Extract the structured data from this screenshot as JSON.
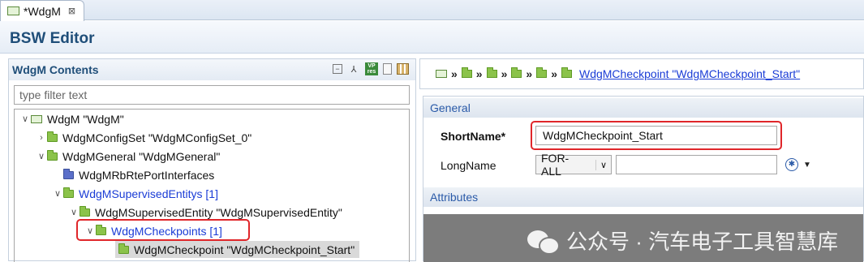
{
  "tab": {
    "label": "*WdgM",
    "close": "⊠"
  },
  "editor": {
    "title": "BSW Editor"
  },
  "contents": {
    "title": "WdgM Contents",
    "filter_placeholder": "type filter text",
    "toolbar_icons": [
      "collapse-all-icon",
      "hierarchy-icon",
      "vp-res-icon",
      "document-icon",
      "table-icon"
    ],
    "tree": [
      {
        "label": "WdgM \"WdgM\"",
        "expanded": true
      },
      {
        "label": "WdgMConfigSet \"WdgMConfigSet_0\"",
        "expanded": false
      },
      {
        "label": "WdgMGeneral \"WdgMGeneral\"",
        "expanded": true
      },
      {
        "label": "WdgMRbRtePortInterfaces"
      },
      {
        "label": "WdgMSupervisedEntitys [1]",
        "expanded": true
      },
      {
        "label": "WdgMSupervisedEntity \"WdgMSupervisedEntity\"",
        "expanded": true
      },
      {
        "label": "WdgMCheckpoints [1]",
        "expanded": true
      },
      {
        "label": "WdgMCheckpoint \"WdgMCheckpoint_Start\"",
        "selected": true
      }
    ]
  },
  "breadcrumb": {
    "separator": "»",
    "link": "WdgMCheckpoint \"WdgMCheckpoint_Start\""
  },
  "general": {
    "title": "General",
    "shortname_label": "ShortName*",
    "shortname_value": "WdgMCheckpoint_Start",
    "longname_label": "LongName",
    "longname_lang": "FOR-ALL",
    "longname_value": ""
  },
  "attributes": {
    "title": "Attributes"
  },
  "watermark": {
    "text": "公众号 · 汽车电子工具智慧库"
  },
  "colors": {
    "highlight": "#e0262a",
    "link": "#1a3cd6",
    "title": "#1f4e79"
  }
}
